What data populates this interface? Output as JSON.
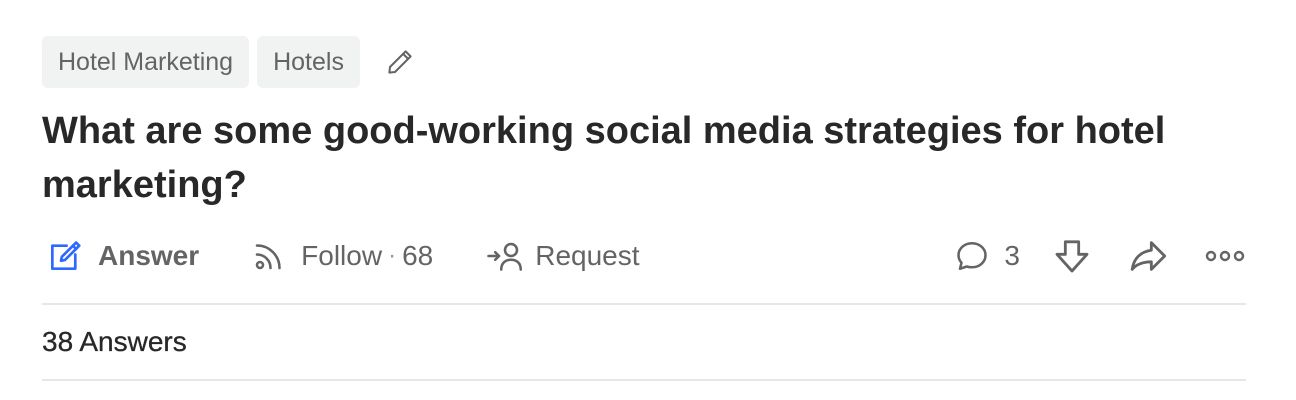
{
  "topics": [
    {
      "label": "Hotel Marketing"
    },
    {
      "label": "Hotels"
    }
  ],
  "edit_icon": "pencil-icon",
  "question": {
    "title": "What are some good-working social media strategies for hotel marketing?"
  },
  "actions": {
    "answer_label": "Answer",
    "answer_icon": "edit-square-icon",
    "answer_icon_color": "#2e69ff",
    "follow_label": "Follow",
    "follow_icon": "rss-icon",
    "follow_separator": "·",
    "follow_count": "68",
    "request_label": "Request",
    "request_icon": "request-user-icon",
    "comment_icon": "comment-icon",
    "comment_count": "3",
    "downvote_icon": "downvote-icon",
    "share_icon": "share-icon",
    "more_icon": "more-icon"
  },
  "answers": {
    "count_label": "38 Answers"
  },
  "colors": {
    "text": "#282829",
    "muted": "#636466",
    "chip_bg": "#f1f2f2",
    "divider": "#e6e7e8",
    "accent": "#2e69ff"
  }
}
